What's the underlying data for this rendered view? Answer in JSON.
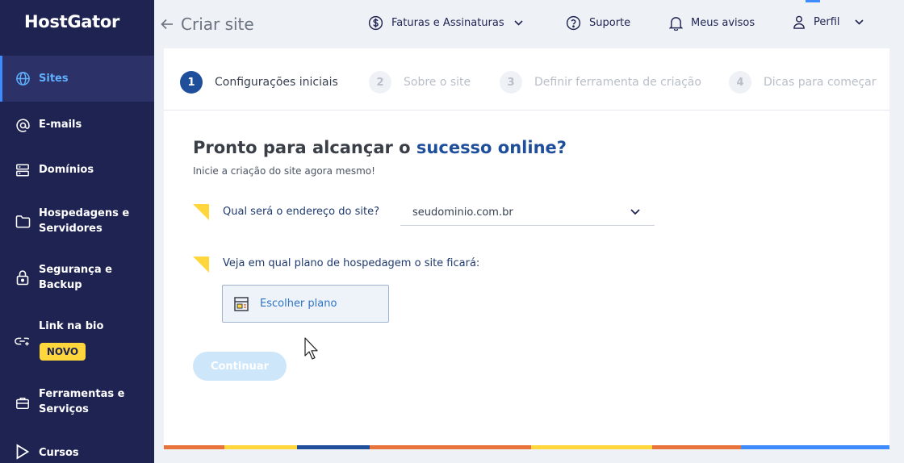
{
  "brand": {
    "logo": "HostGator"
  },
  "sidebar": {
    "items": [
      {
        "label": "Sites",
        "icon": "globe-icon",
        "active": true
      },
      {
        "label": "E-mails",
        "icon": "at-icon"
      },
      {
        "label": "Domínios",
        "icon": "server-icon"
      },
      {
        "label": "Hospedagens e Servidores",
        "icon": "folder-icon"
      },
      {
        "label": "Segurança e Backup",
        "icon": "lock-icon"
      },
      {
        "label": "Link na bio",
        "icon": "link-icon",
        "badge": "NOVO"
      },
      {
        "label": "Ferramentas e Serviços",
        "icon": "tools-icon"
      },
      {
        "label": "Cursos",
        "icon": "play-icon"
      }
    ]
  },
  "header": {
    "back_icon": "arrow-left-icon",
    "title": "Criar site",
    "billing": "Faturas e Assinaturas",
    "support": "Suporte",
    "notices": "Meus avisos",
    "profile": "Perfil"
  },
  "stepper": {
    "steps": [
      {
        "num": "1",
        "label": "Configurações iniciais",
        "active": true
      },
      {
        "num": "2",
        "label": "Sobre o site"
      },
      {
        "num": "3",
        "label": "Definir ferramenta de criação"
      },
      {
        "num": "4",
        "label": "Dicas para começar"
      }
    ]
  },
  "main": {
    "heading_prefix": "Pronto para alcançar o ",
    "heading_highlight": "sucesso online?",
    "subheading": "Inicie a criação do site agora mesmo!",
    "domain_question": "Qual será o endereço do site?",
    "domain_value": "seudominio.com.br",
    "plan_question": "Veja em qual plano de hospedagem o site ficará:",
    "plan_button": "Escolher plano",
    "continue_button": "Continuar"
  },
  "colors": {
    "sidebar_bg": "#1f2352",
    "accent_blue": "#1f4e9a",
    "link_blue": "#2d73c4",
    "highlight_yellow": "#ffd63c",
    "stripe": [
      "#e8743b",
      "#ffd63c",
      "#1f4e9a",
      "#3d8bfd"
    ]
  }
}
